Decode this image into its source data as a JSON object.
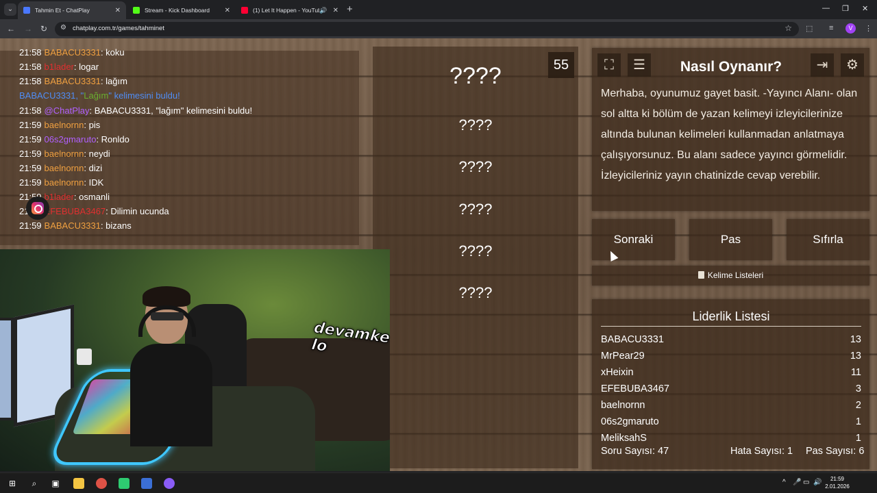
{
  "browser": {
    "tabs": [
      {
        "title": "Tahmin Et - ChatPlay",
        "favicon_color": "#4a78ff",
        "active": true
      },
      {
        "title": "Stream - Kick Dashboard",
        "favicon_color": "#53fc18",
        "active": false
      },
      {
        "title": "(1) Let It Happen - YouTube",
        "favicon_color": "#ff0033",
        "active": false
      }
    ],
    "url": "chatplay.com.tr/games/tahminet",
    "profile_initial": "V"
  },
  "chat": {
    "lines": [
      {
        "time": "21:58",
        "user": "BABACU3331",
        "color": "#f0a040",
        "text": "koku"
      },
      {
        "time": "21:58",
        "user": "b1lader",
        "color": "#e03030",
        "text": "logar"
      },
      {
        "time": "21:58",
        "user": "BABACU3331",
        "color": "#f0a040",
        "text": "lağım"
      },
      {
        "time": "21:58",
        "user": "@ChatPlay",
        "color": "#b060ff",
        "text": "BABACU3331, \"lağım\" kelimesini buldu!"
      },
      {
        "time": "21:59",
        "user": "baelnornn",
        "color": "#f0a040",
        "text": "pis"
      },
      {
        "time": "21:59",
        "user": "06s2gmaruto",
        "color": "#b060ff",
        "text": "Ronldo"
      },
      {
        "time": "21:59",
        "user": "baelnornn",
        "color": "#f0a040",
        "text": "neydi"
      },
      {
        "time": "21:59",
        "user": "baelnornn",
        "color": "#f0a040",
        "text": "dizi"
      },
      {
        "time": "21:59",
        "user": "baelnornn",
        "color": "#f0a040",
        "text": "IDK"
      },
      {
        "time": "21:59",
        "user": "b1lader",
        "color": "#e03030",
        "text": "osmanli"
      },
      {
        "time": "21:59",
        "user": "EFEBUBA3467",
        "color": "#e03030",
        "text": "Dilimin ucunda"
      },
      {
        "time": "21:59",
        "user": "BABACU3331",
        "color": "#f0a040",
        "text": "bizans"
      }
    ],
    "system_line": {
      "before": "BABACU3331, \"",
      "word": "Lağım",
      "after": "\" kelimesini buldu!"
    }
  },
  "webcam": {
    "sticker": "devamke lo"
  },
  "game": {
    "timer": "55",
    "main_word": "????",
    "taboo_words": [
      "????",
      "????",
      "????",
      "????",
      "????"
    ]
  },
  "howto": {
    "title": "Nasıl Oynanır?",
    "text": "Merhaba, oyunumuz gayet basit. -Yayıncı Alanı- olan sol altta ki bölüm de yazan kelimeyi izleyicilerinize altında bulunan kelimeleri kullanmadan anlatmaya çalışıyorsunuz. Bu alanı sadece yayıncı görmelidir. İzleyicileriniz yayın chatinizde cevap verebilir."
  },
  "buttons": {
    "next": "Sonraki",
    "pass": "Pas",
    "reset": "Sıfırla",
    "word_lists": "Kelime Listeleri"
  },
  "leaderboard": {
    "title": "Liderlik Listesi",
    "rows": [
      {
        "name": "BABACU3331",
        "score": "13"
      },
      {
        "name": "MrPear29",
        "score": "13"
      },
      {
        "name": "xHeixin",
        "score": "11"
      },
      {
        "name": "EFEBUBA3467",
        "score": "3"
      },
      {
        "name": "baelnornn",
        "score": "2"
      },
      {
        "name": "06s2gmaruto",
        "score": "1"
      },
      {
        "name": "MeliksahS",
        "score": "1"
      }
    ]
  },
  "stats": {
    "questions": "Soru Sayısı: 47",
    "errors": "Hata Sayısı: 1",
    "passes": "Pas Sayısı: 6"
  },
  "taskbar": {
    "clock_time": "21:59",
    "clock_date": "2.01.2026"
  }
}
